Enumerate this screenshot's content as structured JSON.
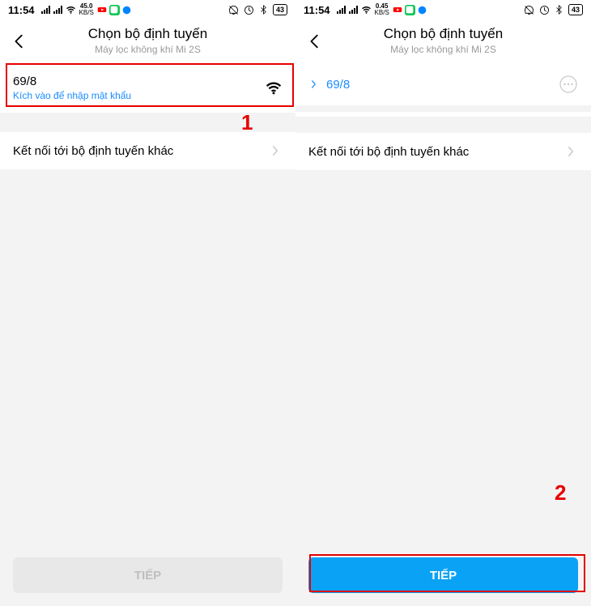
{
  "status": {
    "time": "11:54",
    "kbps_left": "45.0",
    "kbps_right": "0.45",
    "kbps_unit": "KB/S",
    "battery": "43"
  },
  "header": {
    "title": "Chọn bộ định tuyến",
    "subtitle": "Máy lọc không khí Mi 2S"
  },
  "rows": {
    "wifi_name": "69/8",
    "wifi_hint": "Kích vào để nhập mật khẩu",
    "other": "Kết nối tới bộ định tuyến khác"
  },
  "button": {
    "next_disabled": "TIẾP",
    "next_enabled": "TIẾP"
  },
  "annotations": {
    "label1": "1",
    "label2": "2"
  }
}
